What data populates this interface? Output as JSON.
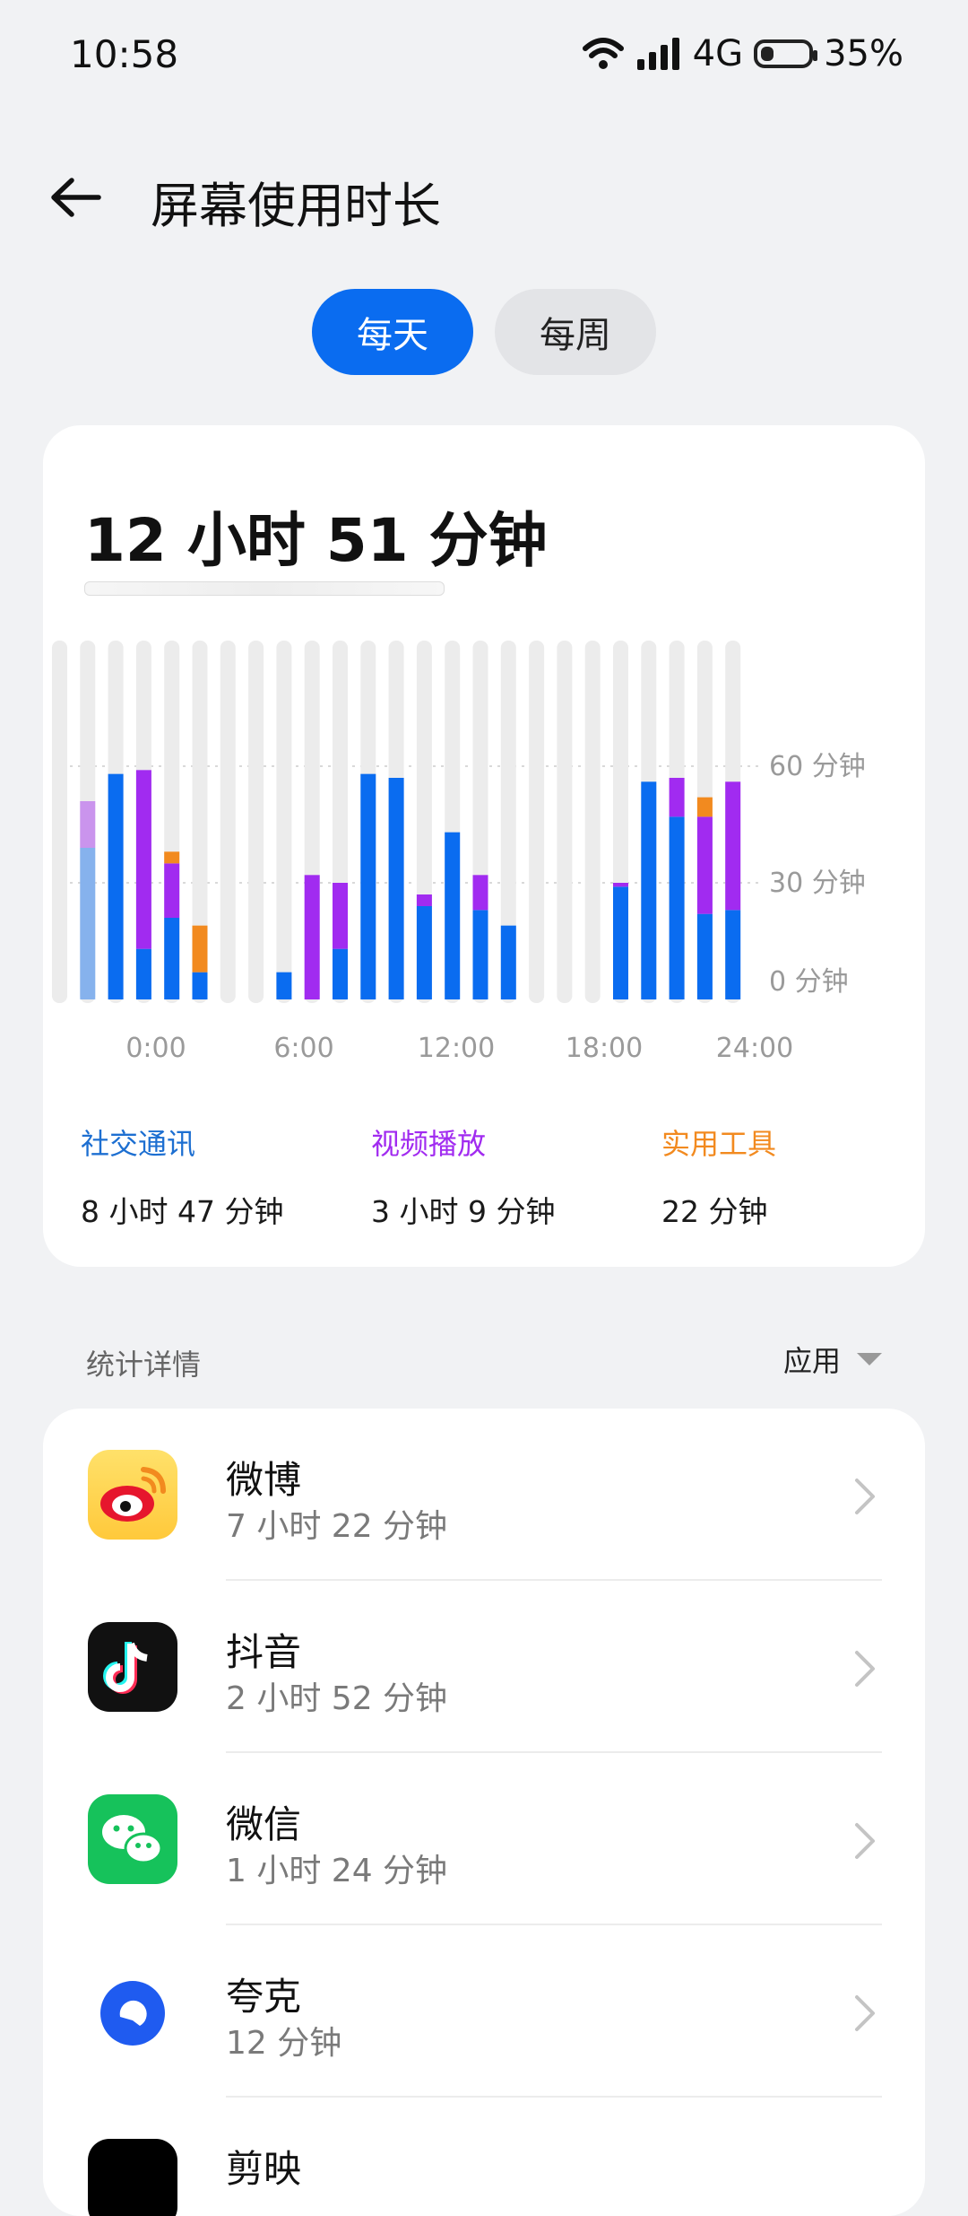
{
  "status_bar": {
    "time": "10:58",
    "network": "4G",
    "battery": "35%"
  },
  "header": {
    "title": "屏幕使用时长"
  },
  "tabs": [
    {
      "label": "每天",
      "active": true
    },
    {
      "label": "每周",
      "active": false
    }
  ],
  "summary": {
    "total": "12 小时 51 分钟"
  },
  "categories": [
    {
      "name": "社交通讯",
      "value": "8 小时 47 分钟",
      "color": "#0a6cf0"
    },
    {
      "name": "视频播放",
      "value": "3 小时 9 分钟",
      "color": "#a12bf0"
    },
    {
      "name": "实用工具",
      "value": "22 分钟",
      "color": "#f28a1f"
    }
  ],
  "chart_data": {
    "type": "bar",
    "stacked": true,
    "x_tick_labels": [
      "0:00",
      "6:00",
      "12:00",
      "18:00",
      "24:00"
    ],
    "y_tick_labels": [
      "60 分钟",
      "30 分钟",
      "0 分钟"
    ],
    "y_ticks": [
      60,
      30,
      0
    ],
    "ylim": [
      0,
      60
    ],
    "series_colors": [
      "#0a6cf0",
      "#a12bf0",
      "#f28a1f"
    ],
    "bars": [
      {
        "segments": [
          0,
          0,
          0
        ],
        "faded": true
      },
      {
        "segments": [
          39,
          12,
          0
        ],
        "faded": true
      },
      {
        "segments": [
          58,
          0,
          0
        ]
      },
      {
        "segments": [
          13,
          46,
          0
        ]
      },
      {
        "segments": [
          21,
          14,
          3
        ]
      },
      {
        "segments": [
          7,
          0,
          12
        ]
      },
      {
        "segments": [
          0,
          0,
          0
        ]
      },
      {
        "segments": [
          0,
          0,
          0
        ]
      },
      {
        "segments": [
          7,
          0,
          0
        ]
      },
      {
        "segments": [
          0,
          32,
          0
        ]
      },
      {
        "segments": [
          13,
          17,
          0
        ]
      },
      {
        "segments": [
          58,
          0,
          0
        ]
      },
      {
        "segments": [
          57,
          0,
          0
        ]
      },
      {
        "segments": [
          24,
          3,
          0
        ]
      },
      {
        "segments": [
          43,
          0,
          0
        ]
      },
      {
        "segments": [
          23,
          9,
          0
        ]
      },
      {
        "segments": [
          19,
          0,
          0
        ]
      },
      {
        "segments": [
          0,
          0,
          0
        ]
      },
      {
        "segments": [
          0,
          0,
          0
        ]
      },
      {
        "segments": [
          0,
          0,
          0
        ]
      },
      {
        "segments": [
          29,
          1,
          0
        ]
      },
      {
        "segments": [
          56,
          0,
          0
        ]
      },
      {
        "segments": [
          47,
          10,
          0
        ]
      },
      {
        "segments": [
          22,
          25,
          5
        ]
      },
      {
        "segments": [
          23,
          33,
          0
        ]
      }
    ]
  },
  "details": {
    "heading": "统计详情",
    "filter_label": "应用"
  },
  "apps": [
    {
      "name": "微博",
      "time": "7 小时 22 分钟",
      "icon": "weibo-icon"
    },
    {
      "name": "抖音",
      "time": "2 小时 52 分钟",
      "icon": "douyin-icon"
    },
    {
      "name": "微信",
      "time": "1 小时 24 分钟",
      "icon": "wechat-icon"
    },
    {
      "name": "夸克",
      "time": "12 分钟",
      "icon": "quark-icon"
    },
    {
      "name": "剪映",
      "time": "",
      "icon": "jianying-icon"
    }
  ]
}
